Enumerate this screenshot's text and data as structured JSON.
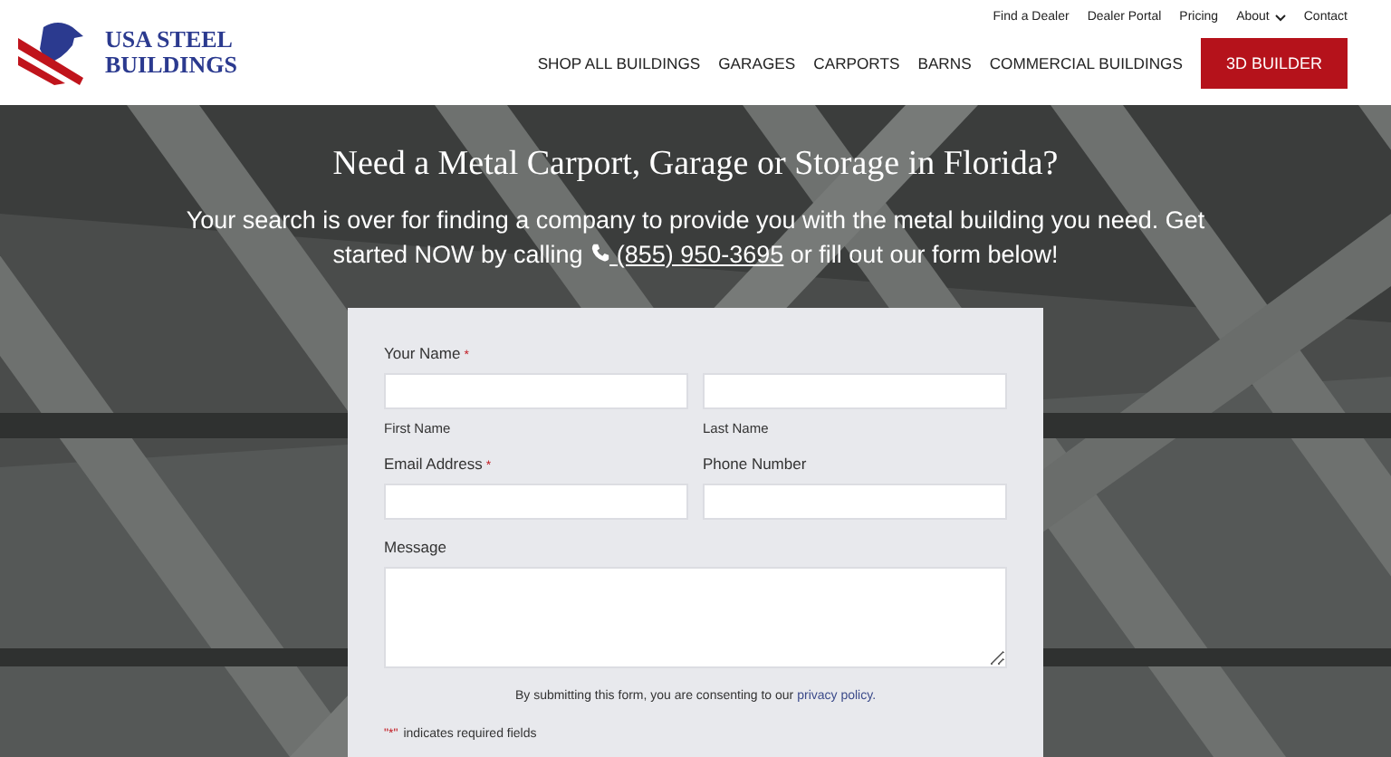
{
  "header": {
    "logo_lines": [
      "USA STEEL",
      "BUILDINGS"
    ],
    "top_links": [
      {
        "label": "Find a Dealer",
        "dropdown": false
      },
      {
        "label": "Dealer Portal",
        "dropdown": false
      },
      {
        "label": "Pricing",
        "dropdown": false
      },
      {
        "label": "About",
        "dropdown": true
      },
      {
        "label": "Contact",
        "dropdown": false
      }
    ],
    "nav": [
      "SHOP ALL BUILDINGS",
      "GARAGES",
      "CARPORTS",
      "BARNS",
      "COMMERCIAL BUILDINGS"
    ],
    "cta": "3D BUILDER"
  },
  "hero": {
    "title": "Need a Metal Carport, Garage or Storage in Florida?",
    "text_before": "Your search is over for finding a company to provide you with the metal building you need. Get started NOW by calling",
    "phone": "(855) 950-3695",
    "text_after": "or fill out our form below!"
  },
  "form": {
    "rows": [
      {
        "label": "Your Name",
        "required": true,
        "fields": [
          {
            "sublabel": "First Name"
          },
          {
            "sublabel": "Last Name"
          }
        ]
      },
      {
        "columns": [
          {
            "label": "Email Address",
            "required": true
          },
          {
            "label": "Phone Number",
            "required": false
          }
        ]
      },
      {
        "label": "Message",
        "required": false,
        "kind": "textarea"
      }
    ],
    "consent_text": "By submitting this form, you are consenting to our",
    "consent_link": "privacy policy.",
    "required_mark": "*",
    "footnote_mark": "\"*\"",
    "footnote": "indicates required fields"
  }
}
